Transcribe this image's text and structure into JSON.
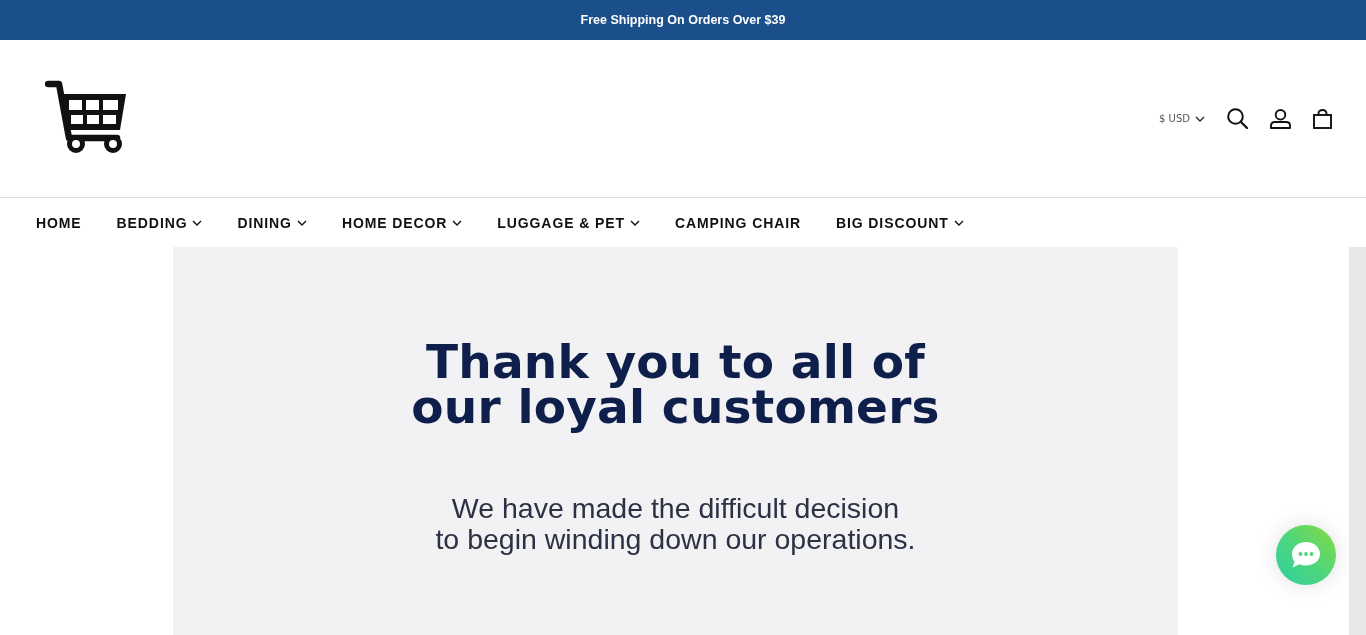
{
  "announcement_bar": {
    "text": "Free Shipping On Orders Over $39"
  },
  "header": {
    "currency": {
      "label": "$ USD",
      "has_dropdown": true
    }
  },
  "nav": {
    "items": [
      {
        "label": "HOME",
        "has_dropdown": false
      },
      {
        "label": "BEDDING",
        "has_dropdown": true
      },
      {
        "label": "DINING",
        "has_dropdown": true
      },
      {
        "label": "HOME DECOR",
        "has_dropdown": true
      },
      {
        "label": "LUGGAGE & PET",
        "has_dropdown": true
      },
      {
        "label": "CAMPING CHAIR",
        "has_dropdown": false
      },
      {
        "label": "BIG DISCOUNT",
        "has_dropdown": true
      }
    ]
  },
  "hero_banner": {
    "headline_lines": [
      "Thank you to all of",
      "our loyal customers"
    ],
    "body_lines": [
      "We have made the difficult decision",
      "to begin winding down our operations."
    ]
  }
}
